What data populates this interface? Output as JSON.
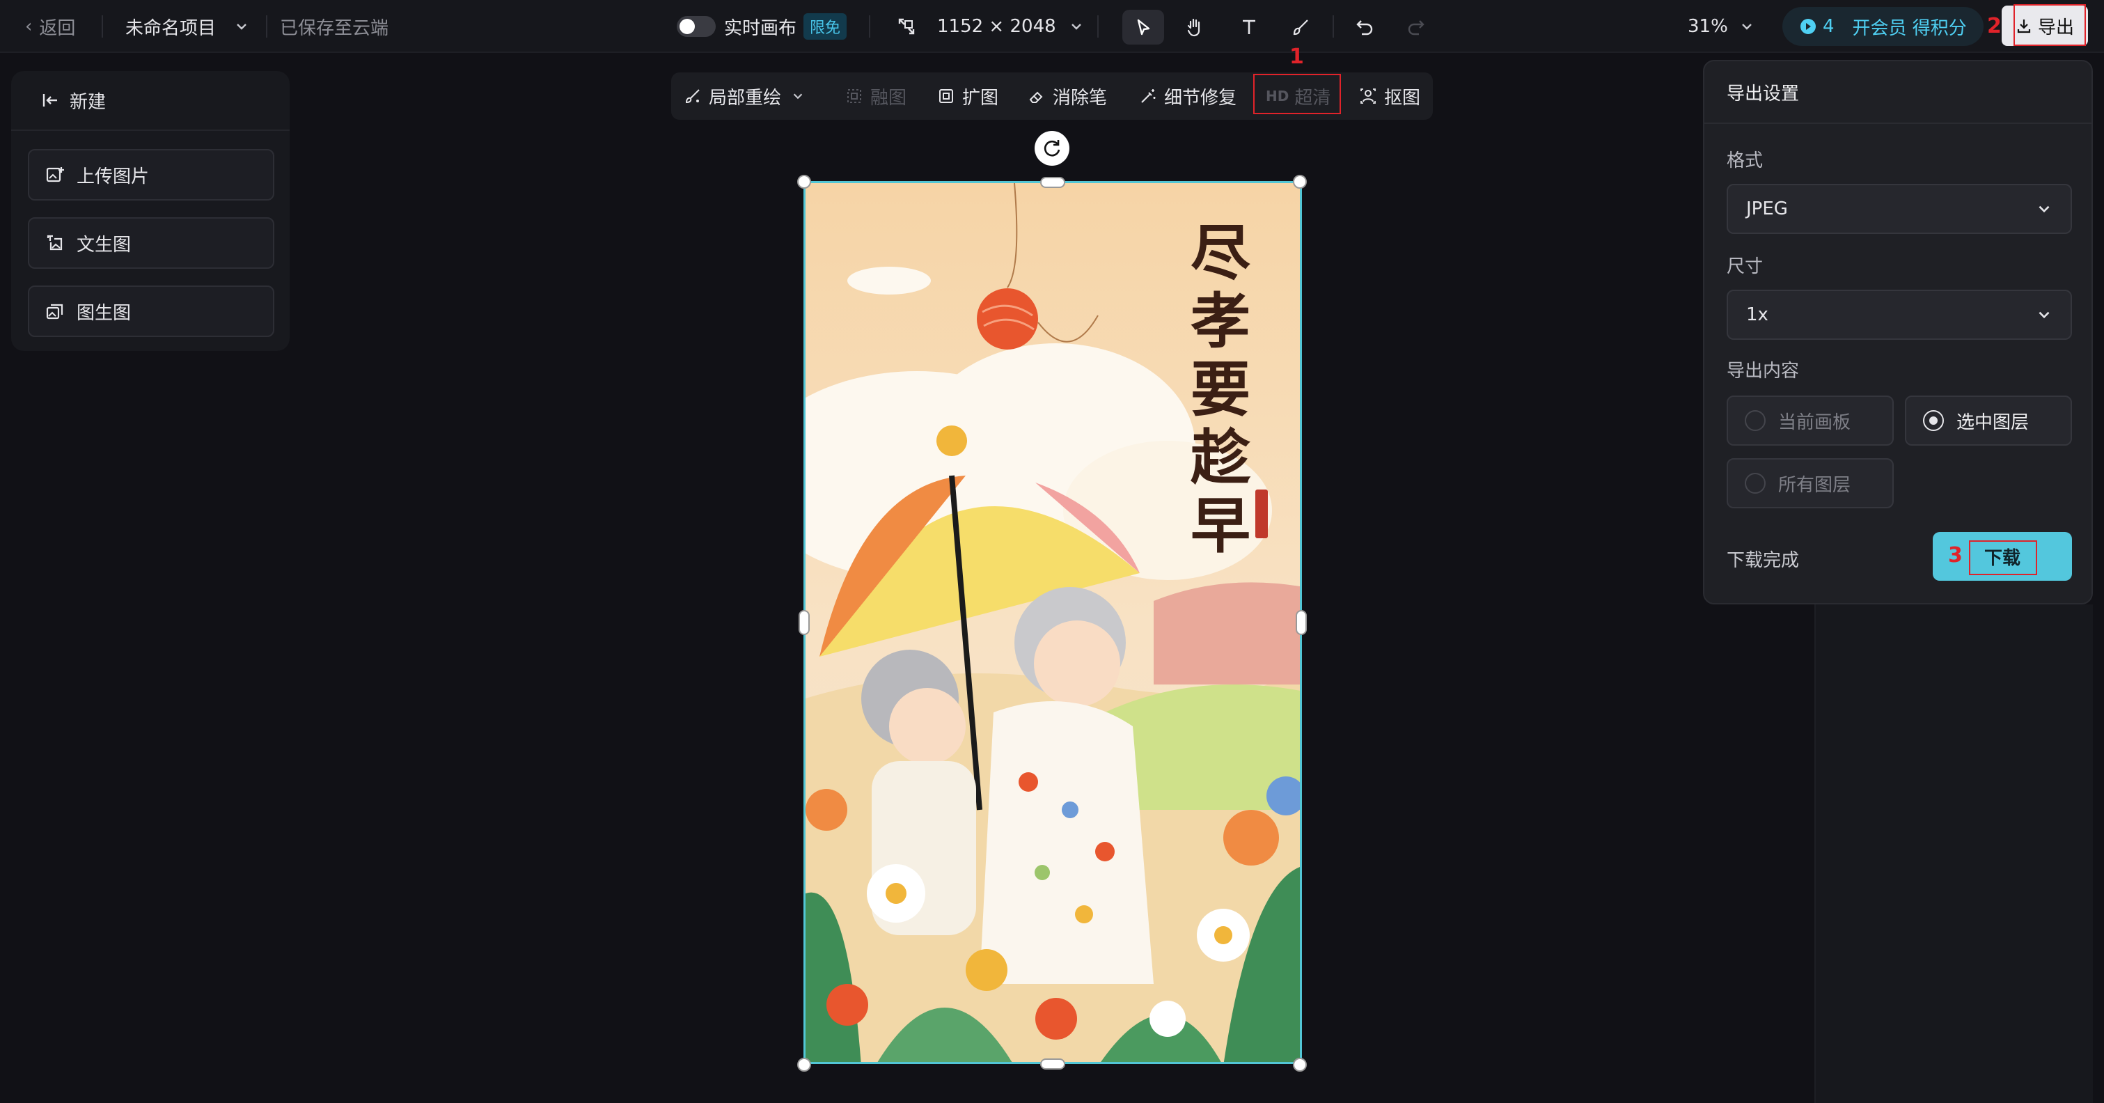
{
  "topbar": {
    "back_label": "返回",
    "project_name": "未命名项目",
    "save_status": "已保存至云端",
    "realtime_label": "实时画布",
    "limited_badge": "限免",
    "canvas_size": "1152 × 2048",
    "zoom": "31%",
    "credits": "4",
    "vip_label": "开会员 得积分",
    "export_label": "导出"
  },
  "annotations": {
    "n1": "1",
    "n2": "2",
    "n3": "3"
  },
  "left_panel": {
    "new_label": "新建",
    "buttons": [
      "上传图片",
      "文生图",
      "图生图"
    ]
  },
  "toolbar": {
    "items": [
      "局部重绘",
      "融图",
      "扩图",
      "消除笔",
      "细节修复",
      "超清",
      "抠图"
    ],
    "hd_tag": "HD"
  },
  "poster": {
    "title_chars": [
      "尽",
      "孝",
      "要",
      "趁",
      "早"
    ]
  },
  "export_panel": {
    "title": "导出设置",
    "format_label": "格式",
    "format_value": "JPEG",
    "size_label": "尺寸",
    "size_value": "1x",
    "content_label": "导出内容",
    "content_options": [
      "当前画板",
      "选中图层",
      "所有图层"
    ],
    "selected_option": "选中图层",
    "status": "下载完成",
    "download_label": "下载"
  },
  "colors": {
    "accent": "#53c7dd",
    "selection": "#52c6d5",
    "annotation": "#e0232a"
  }
}
